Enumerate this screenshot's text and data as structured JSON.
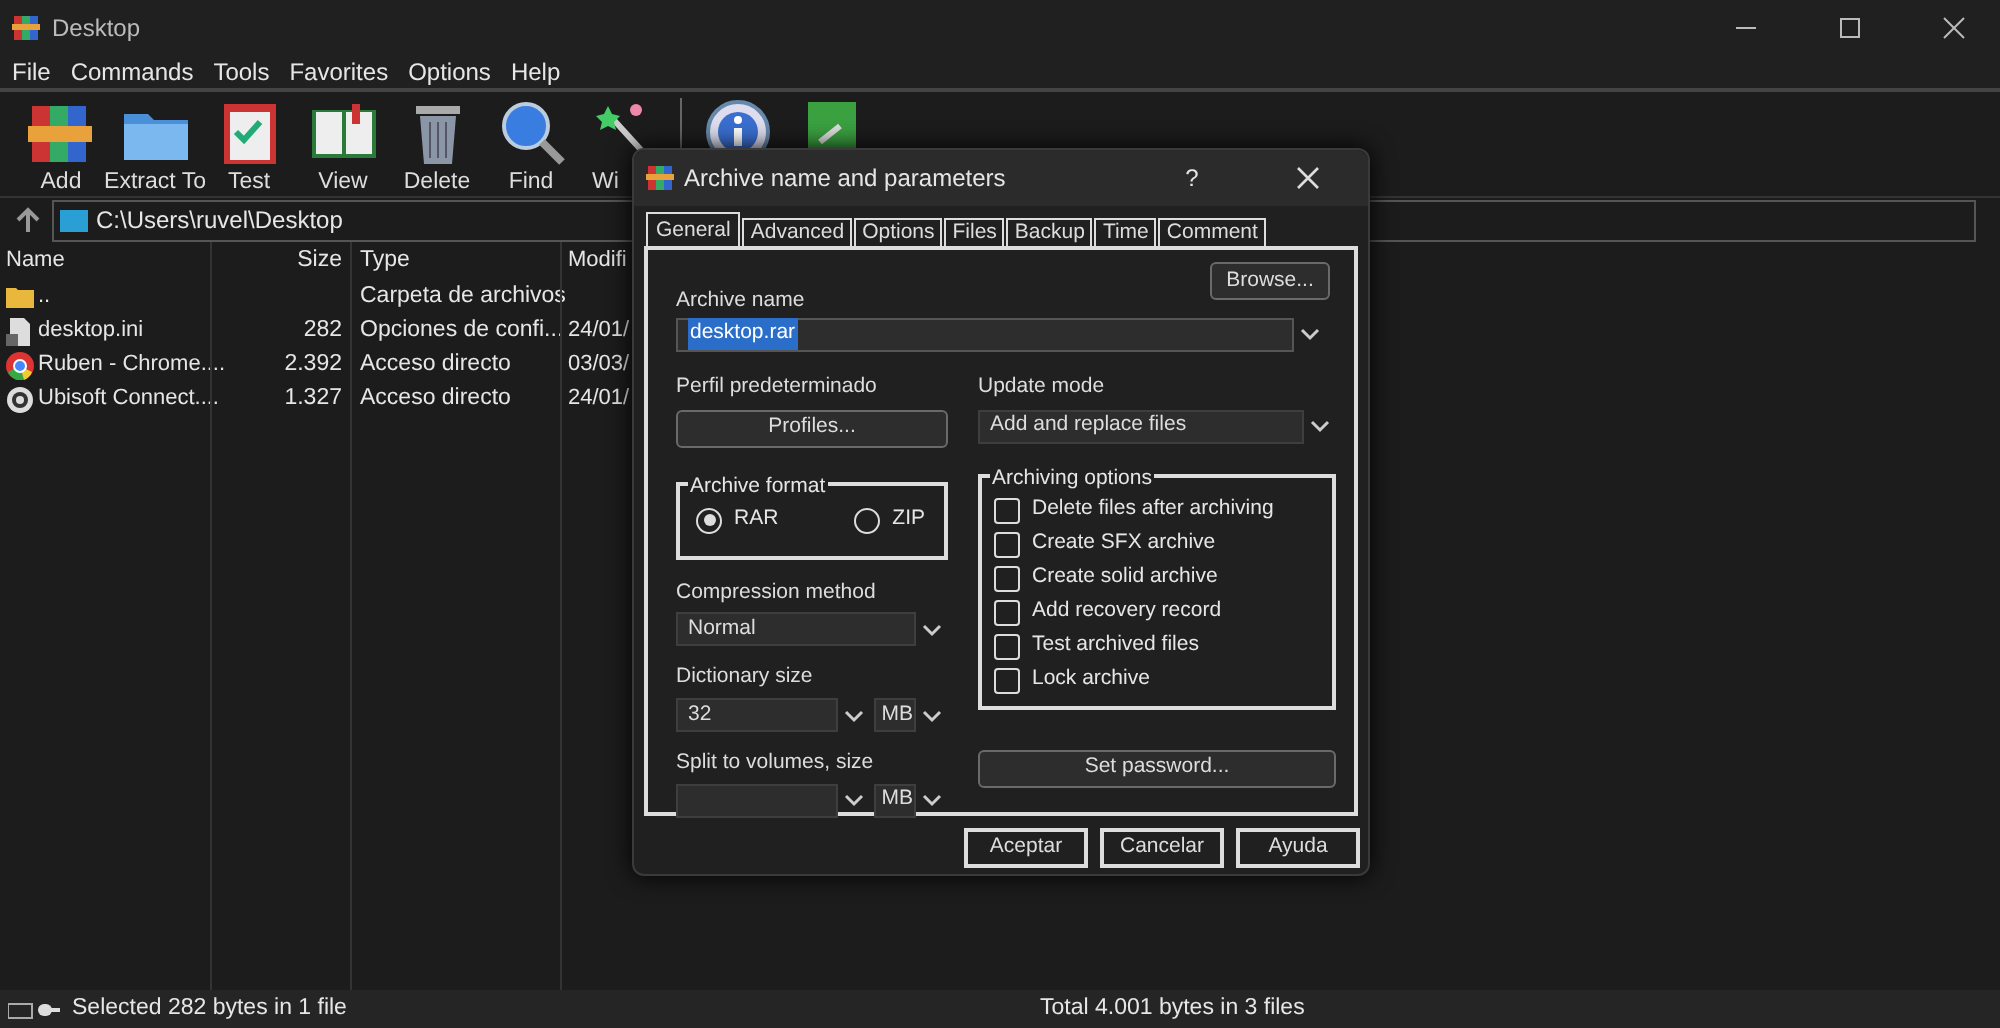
{
  "window": {
    "title": "Desktop"
  },
  "menu": [
    "File",
    "Commands",
    "Tools",
    "Favorites",
    "Options",
    "Help"
  ],
  "toolbar": [
    {
      "kind": "labeled",
      "label": "Add"
    },
    {
      "kind": "labeled",
      "label": "Extract To"
    },
    {
      "kind": "labeled",
      "label": "Test"
    },
    {
      "kind": "labeled",
      "label": "View"
    },
    {
      "kind": "labeled",
      "label": "Delete"
    },
    {
      "kind": "labeled",
      "label": "Find"
    },
    {
      "kind": "labeled",
      "label": "Wi"
    },
    {
      "kind": "icon_only"
    },
    {
      "kind": "icon_only"
    }
  ],
  "address": {
    "path": "C:\\Users\\ruvel\\Desktop"
  },
  "file_list": {
    "columns": [
      "Name",
      "Size",
      "Type",
      "Modifi"
    ],
    "rows": [
      {
        "kind": "folder",
        "name": "..",
        "size": "",
        "type": "Carpeta de archivos",
        "modified": ""
      },
      {
        "kind": "file",
        "name": "desktop.ini",
        "size": "282",
        "type": "Opciones de confi...",
        "modified": "24/01/"
      },
      {
        "kind": "chrome",
        "name": "Ruben - Chrome....",
        "size": "2.392",
        "type": "Acceso directo",
        "modified": "03/03/"
      },
      {
        "kind": "ubisoft",
        "name": "Ubisoft Connect....",
        "size": "1.327",
        "type": "Acceso directo",
        "modified": "24/01/"
      }
    ]
  },
  "dialog": {
    "title": "Archive name and parameters",
    "help": "?",
    "tabs": [
      {
        "label": "General",
        "selected": true
      },
      {
        "label": "Advanced",
        "selected": false
      },
      {
        "label": "Options",
        "selected": false
      },
      {
        "label": "Files",
        "selected": false
      },
      {
        "label": "Backup",
        "selected": false
      },
      {
        "label": "Time",
        "selected": false
      },
      {
        "label": "Comment",
        "selected": false
      }
    ],
    "archive_name": {
      "label": "Archive name",
      "value": "desktop.rar",
      "browse": "Browse..."
    },
    "profile": {
      "label": "Perfil predeterminado",
      "button": "Profiles..."
    },
    "update_mode": {
      "label": "Update mode",
      "value": "Add and replace files"
    },
    "archive_format": {
      "label": "Archive format",
      "options": [
        {
          "label": "RAR",
          "selected": true
        },
        {
          "label": "ZIP",
          "selected": false
        }
      ]
    },
    "compression": {
      "label": "Compression method",
      "value": "Normal"
    },
    "dictionary": {
      "label": "Dictionary size",
      "value": "32",
      "unit": "MB"
    },
    "split": {
      "label": "Split to volumes, size",
      "unit": "MB"
    },
    "archiving_options": {
      "label": "Archiving options",
      "options": [
        {
          "label": "Delete files after archiving",
          "checked": false
        },
        {
          "label": "Create SFX archive",
          "checked": false
        },
        {
          "label": "Create solid archive",
          "checked": false
        },
        {
          "label": "Add recovery record",
          "checked": false
        },
        {
          "label": "Test archived files",
          "checked": false
        },
        {
          "label": "Lock archive",
          "checked": false
        }
      ]
    },
    "set_password": "Set password...",
    "buttons": [
      "Aceptar",
      "Cancelar",
      "Ayuda"
    ]
  },
  "status_bar": {
    "left": "Selected 282 bytes in 1 file",
    "right": "Total 4.001 bytes in 3 files"
  }
}
